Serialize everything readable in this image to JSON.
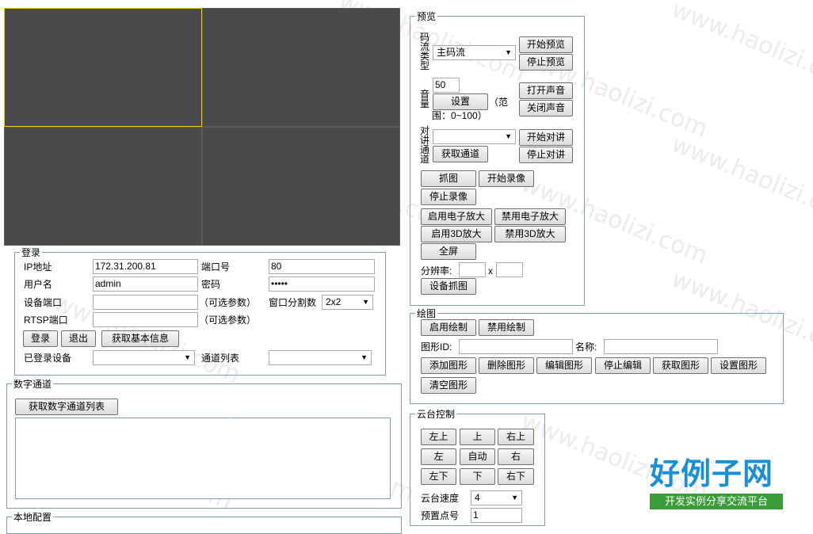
{
  "watermark_text": "www.haolizi.com",
  "login": {
    "legend": "登录",
    "ip_label": "IP地址",
    "ip_value": "172.31.200.81",
    "port_label": "端口号",
    "port_value": "80",
    "user_label": "用户名",
    "user_value": "admin",
    "password_label": "密码",
    "password_value": "•••••",
    "device_port_label": "设备端口",
    "optional1": "（可选参数）",
    "split_label": "窗口分割数",
    "split_value": "2x2",
    "rtsp_label": "RTSP端口",
    "optional2": "（可选参数）",
    "login_btn": "登录",
    "logout_btn": "退出",
    "get_info_btn": "获取基本信息",
    "logged_devices_label": "已登录设备",
    "channel_list_label": "通道列表"
  },
  "digital": {
    "legend": "数字通道",
    "get_list_btn": "获取数字通道列表"
  },
  "local": {
    "legend": "本地配置"
  },
  "preview": {
    "legend": "预览",
    "stream_type_label": "码流类型",
    "stream_type_value": "主码流",
    "start_preview": "开始预览",
    "stop_preview": "停止预览",
    "volume_label": "音量",
    "volume_value": "50",
    "set_btn": "设置",
    "range_text1": "（范",
    "range_text2": "围：0~100）",
    "open_sound": "打开声音",
    "close_sound": "关闭声音",
    "talk_channel_label": "对讲通道",
    "get_channel_btn": "获取通道",
    "start_talk": "开始对讲",
    "stop_talk": "停止对讲",
    "capture": "抓图",
    "start_record": "开始录像",
    "stop_record": "停止录像",
    "enable_ezoom": "启用电子放大",
    "disable_ezoom": "禁用电子放大",
    "enable_3d": "启用3D放大",
    "disable_3d": "禁用3D放大",
    "fullscreen": "全屏",
    "resolution_label": "分辨率:",
    "x_sep": "x",
    "device_capture": "设备抓图"
  },
  "drawing": {
    "legend": "绘图",
    "enable_draw": "启用绘制",
    "disable_draw": "禁用绘制",
    "shape_id_label": "图形ID:",
    "name_label": "名称:",
    "add_shape": "添加图形",
    "delete_shape": "删除图形",
    "edit_shape": "编辑图形",
    "stop_edit": "停止编辑",
    "get_shape": "获取图形",
    "set_shape": "设置图形",
    "clear_shape": "清空图形"
  },
  "ptz": {
    "legend": "云台控制",
    "up_left": "左上",
    "up": "上",
    "up_right": "右上",
    "left": "左",
    "auto": "自动",
    "right": "右",
    "down_left": "左下",
    "down": "下",
    "down_right": "右下",
    "speed_label": "云台速度",
    "speed_value": "4",
    "preset_label": "预置点号",
    "preset_value": "1"
  },
  "logo": {
    "title": "好例子网",
    "subtitle": "开发实例分享交流平台"
  },
  "colors": {
    "pane": "#4a4a4a",
    "selected_border": "#ffcc00",
    "fieldset_border": "#7f9db9",
    "logo_blue": "#1a8fd8",
    "logo_green": "#3a9d3a"
  }
}
